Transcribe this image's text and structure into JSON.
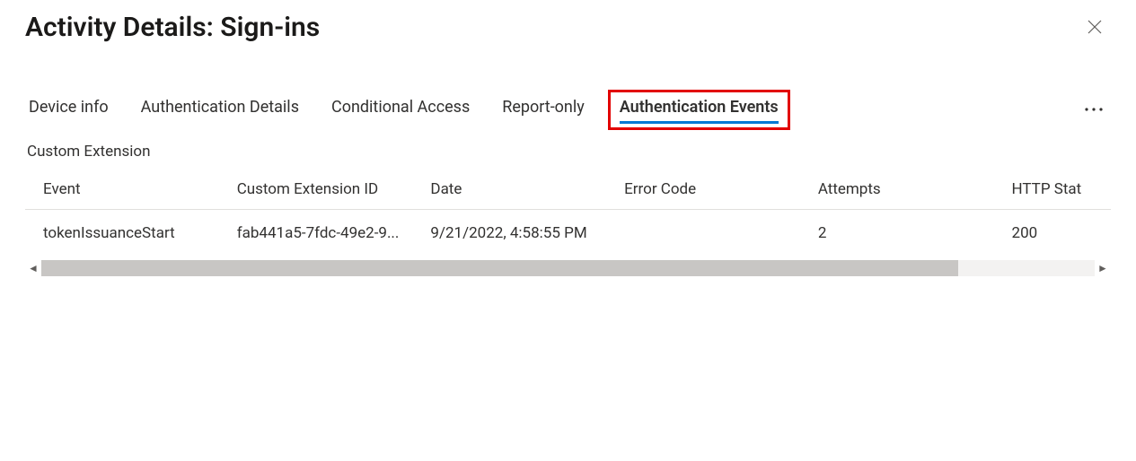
{
  "header": {
    "title": "Activity Details: Sign-ins"
  },
  "tabs": {
    "items": [
      {
        "label": "Device info"
      },
      {
        "label": "Authentication Details"
      },
      {
        "label": "Conditional Access"
      },
      {
        "label": "Report-only"
      },
      {
        "label": "Authentication Events"
      }
    ],
    "active_index": 4
  },
  "section": {
    "label": "Custom Extension"
  },
  "table": {
    "columns": {
      "event": "Event",
      "extension_id": "Custom Extension ID",
      "date": "Date",
      "error_code": "Error Code",
      "attempts": "Attempts",
      "http_status": "HTTP Stat"
    },
    "rows": [
      {
        "event": "tokenIssuanceStart",
        "extension_id": "fab441a5-7fdc-49e2-9...",
        "date": "9/21/2022, 4:58:55 PM",
        "error_code": "",
        "attempts": "2",
        "http_status": "200"
      }
    ]
  }
}
